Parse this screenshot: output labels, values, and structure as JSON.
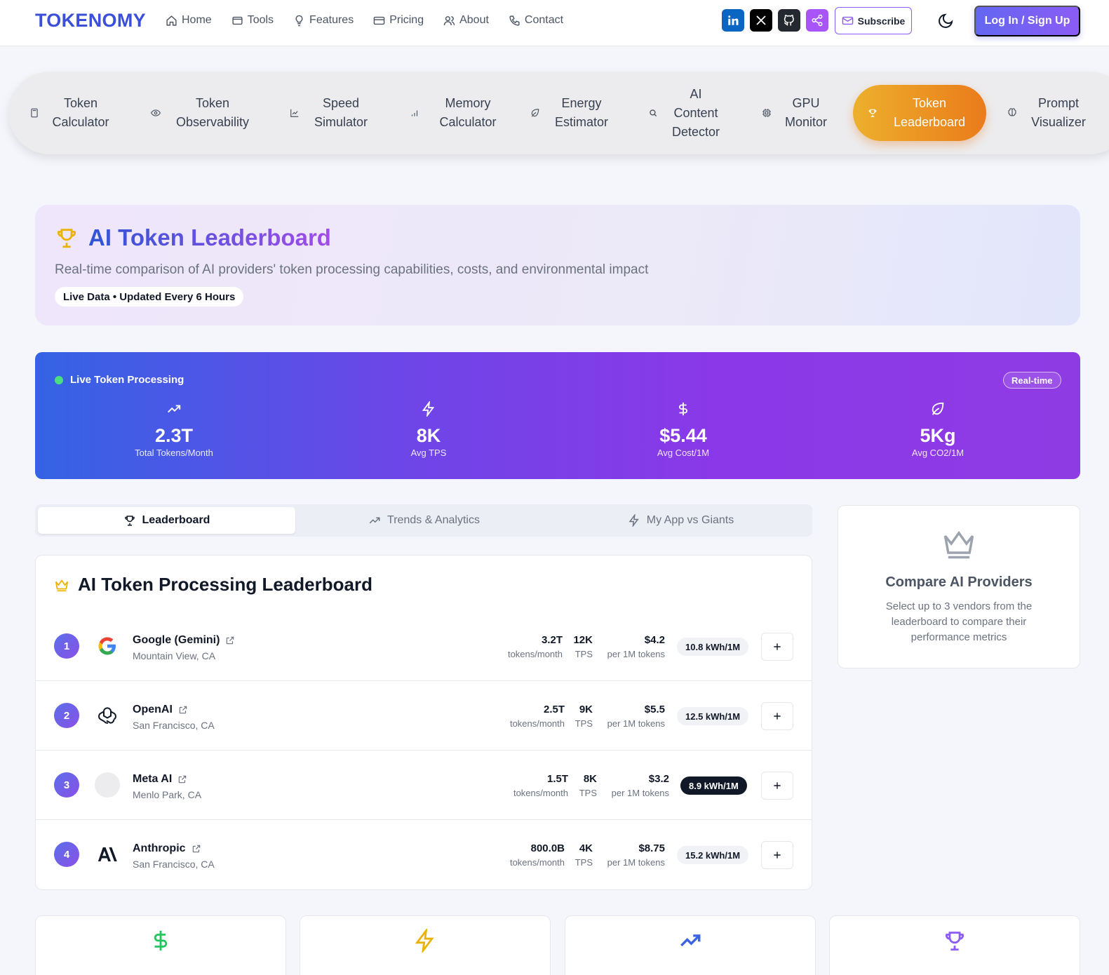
{
  "brand": "TOKENOMY",
  "nav": {
    "links": [
      {
        "label": "Home",
        "icon": "home-icon"
      },
      {
        "label": "Tools",
        "icon": "window-icon"
      },
      {
        "label": "Features",
        "icon": "lightbulb-icon"
      },
      {
        "label": "Pricing",
        "icon": "credit-card-icon"
      },
      {
        "label": "About",
        "icon": "users-icon"
      },
      {
        "label": "Contact",
        "icon": "phone-icon"
      }
    ],
    "social": [
      "linkedin-icon",
      "x-icon",
      "github-icon",
      "share-icon"
    ],
    "subscribe_label": "Subscribe",
    "login_label": "Log In / Sign Up"
  },
  "tools": [
    {
      "label": "Token Calculator",
      "icon": "calculator-icon"
    },
    {
      "label": "Token Observability",
      "icon": "eye-icon"
    },
    {
      "label": "Speed Simulator",
      "icon": "chart-line-icon"
    },
    {
      "label": "Memory Calculator",
      "icon": "bar-chart-icon"
    },
    {
      "label": "Energy Estimator",
      "icon": "leaf-icon"
    },
    {
      "label": "AI Content Detector",
      "icon": "search-icon"
    },
    {
      "label": "GPU Monitor",
      "icon": "cpu-icon"
    },
    {
      "label": "Token Leaderboard",
      "icon": "trophy-icon",
      "active": true
    },
    {
      "label": "Prompt Visualizer",
      "icon": "brain-icon"
    }
  ],
  "hero": {
    "title": "AI Token Leaderboard",
    "subtitle": "Real-time comparison of AI providers' token processing capabilities, costs, and environmental impact",
    "badge": "Live Data • Updated Every 6 Hours"
  },
  "live": {
    "heading": "Live Token Processing",
    "badge": "Real-time",
    "stats": [
      {
        "value": "2.3T",
        "label": "Total Tokens/Month",
        "icon": "trending-up-icon"
      },
      {
        "value": "8K",
        "label": "Avg TPS",
        "icon": "lightning-icon"
      },
      {
        "value": "$5.44",
        "label": "Avg Cost/1M",
        "icon": "dollar-icon"
      },
      {
        "value": "5Kg",
        "label": "Avg CO2/1M",
        "icon": "leaf-icon"
      }
    ]
  },
  "tabs": [
    {
      "label": "Leaderboard",
      "icon": "trophy-icon",
      "active": true
    },
    {
      "label": "Trends & Analytics",
      "icon": "trending-up-icon"
    },
    {
      "label": "My App vs Giants",
      "icon": "lightning-icon"
    }
  ],
  "leaderboard": {
    "title": "AI Token Processing Leaderboard",
    "rows": [
      {
        "rank": "1",
        "name": "Google (Gemini)",
        "location": "Mountain View, CA",
        "tokens": "3.2T",
        "tokens_label": "tokens/month",
        "tps": "12K",
        "tps_label": "TPS",
        "cost": "$4.2",
        "cost_label": "per 1M tokens",
        "energy": "10.8 kWh/1M",
        "logo": "google-logo-icon"
      },
      {
        "rank": "2",
        "name": "OpenAI",
        "location": "San Francisco, CA",
        "tokens": "2.5T",
        "tokens_label": "tokens/month",
        "tps": "9K",
        "tps_label": "TPS",
        "cost": "$5.5",
        "cost_label": "per 1M tokens",
        "energy": "12.5 kWh/1M",
        "logo": "openai-logo-icon"
      },
      {
        "rank": "3",
        "name": "Meta AI",
        "location": "Menlo Park, CA",
        "tokens": "1.5T",
        "tokens_label": "tokens/month",
        "tps": "8K",
        "tps_label": "TPS",
        "cost": "$3.2",
        "cost_label": "per 1M tokens",
        "energy": "8.9 kWh/1M",
        "logo": "meta-logo-placeholder",
        "highlight": true
      },
      {
        "rank": "4",
        "name": "Anthropic",
        "location": "San Francisco, CA",
        "tokens": "800.0B",
        "tokens_label": "tokens/month",
        "tps": "4K",
        "tps_label": "TPS",
        "cost": "$8.75",
        "cost_label": "per 1M tokens",
        "energy": "15.2 kWh/1M",
        "logo": "anthropic-logo-icon"
      }
    ]
  },
  "compare": {
    "title": "Compare AI Providers",
    "description": "Select up to 3 vendors from the leaderboard to compare their performance metrics"
  },
  "summary": [
    {
      "icon": "dollar-icon",
      "color": "#22c55e"
    },
    {
      "icon": "lightning-icon",
      "color": "#eab308"
    },
    {
      "icon": "trending-up-icon",
      "color": "#3b63e4"
    },
    {
      "icon": "trophy-icon",
      "color": "#8b5cf6"
    }
  ],
  "colors": {
    "brand": "#3b4fd8",
    "accent": "#8b5cf6",
    "active_tool": "#ea7b1b",
    "live_dot": "#4ade80"
  }
}
